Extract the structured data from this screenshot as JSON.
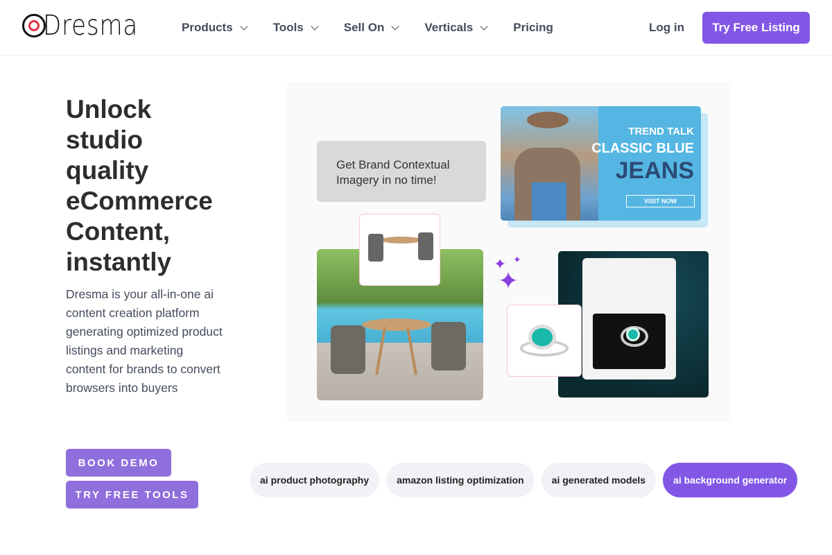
{
  "brand": {
    "name": "Dresma",
    "accent": "#8257e6",
    "logo_red": "#e53245"
  },
  "nav": {
    "items": [
      {
        "label": "Products",
        "dropdown": true
      },
      {
        "label": "Tools",
        "dropdown": true
      },
      {
        "label": "Sell On",
        "dropdown": true
      },
      {
        "label": "Verticals",
        "dropdown": true
      },
      {
        "label": "Pricing",
        "dropdown": false
      }
    ],
    "login": "Log in",
    "cta": "Try Free Listing"
  },
  "hero": {
    "title": "Unlock studio quality eCommerce Content, instantly",
    "description": "Dresma is your all-in-one ai content creation platform generating optimized product listings and marketing content for brands to convert browsers into buyers",
    "buttons": {
      "book_demo": "BOOK DEMO",
      "try_tools": "TRY FREE TOOLS"
    }
  },
  "collage": {
    "bubble": "Get Brand Contextual Imagery in no time!",
    "banner": {
      "line1": "TREND TALK",
      "line2": "CLASSIC BLUE",
      "line3": "JEANS",
      "button": "VISIT NOW"
    }
  },
  "chips": [
    {
      "label": "ai product photography",
      "active": false
    },
    {
      "label": "amazon listing optimization",
      "active": false
    },
    {
      "label": "ai generated models",
      "active": false
    },
    {
      "label": "ai background generator",
      "active": true
    }
  ]
}
